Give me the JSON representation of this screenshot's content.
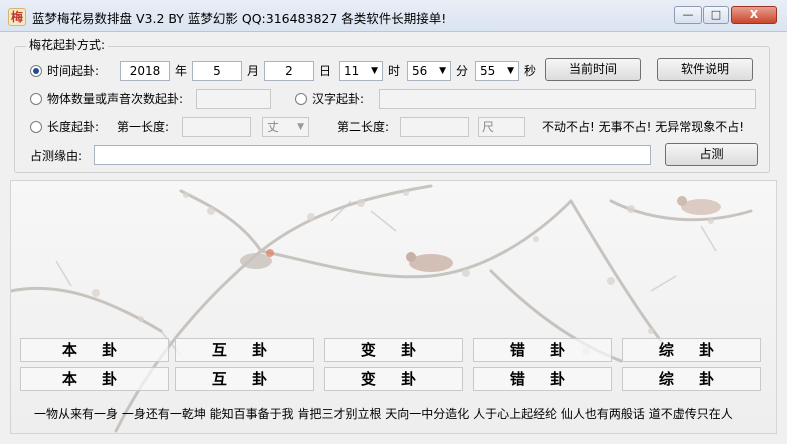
{
  "window": {
    "title": "蓝梦梅花易数排盘 V3.2  BY 蓝梦幻影 QQ:316483827  各类软件长期接单!",
    "icon": "plum-blossom-app-icon",
    "minimize_label": "—",
    "maximize_label": "□",
    "close_label": "X"
  },
  "group": {
    "label": "梅花起卦方式:"
  },
  "time_row": {
    "radio_label": "时间起卦:",
    "selected": true,
    "year_value": "2018",
    "year_unit": "年",
    "month_value": "5",
    "month_unit": "月",
    "day_value": "2",
    "day_unit": "日",
    "hour_value": "11",
    "hour_unit": "时",
    "minute_value": "56",
    "minute_unit": "分",
    "second_value": "55",
    "second_unit": "秒",
    "current_time_button": "当前时间",
    "help_button": "软件说明"
  },
  "object_row": {
    "radio_label": "物体数量或声音次数起卦:",
    "value": "",
    "hanzi_radio_label": "汉字起卦:",
    "hanzi_value": ""
  },
  "length_row": {
    "radio_label": "长度起卦:",
    "first_label": "第一长度:",
    "first_value": "",
    "first_unit": "丈",
    "second_label": "第二长度:",
    "second_value": "",
    "second_unit": "尺",
    "notice": "不动不占!  无事不占!  无异常现象不占!"
  },
  "reason_row": {
    "label": "占测缘由:",
    "value": "",
    "divine_button": "占测"
  },
  "gua_rows": [
    [
      "本 卦",
      "互 卦",
      "变 卦",
      "错 卦",
      "综 卦"
    ],
    [
      "本 卦",
      "互 卦",
      "变 卦",
      "错 卦",
      "综 卦"
    ]
  ],
  "poem": "一物从来有一身  一身还有一乾坤  能知百事备于我  肯把三才别立根  天向一中分造化  人于心上起经纶  仙人也有两般话  道不虚传只在人"
}
